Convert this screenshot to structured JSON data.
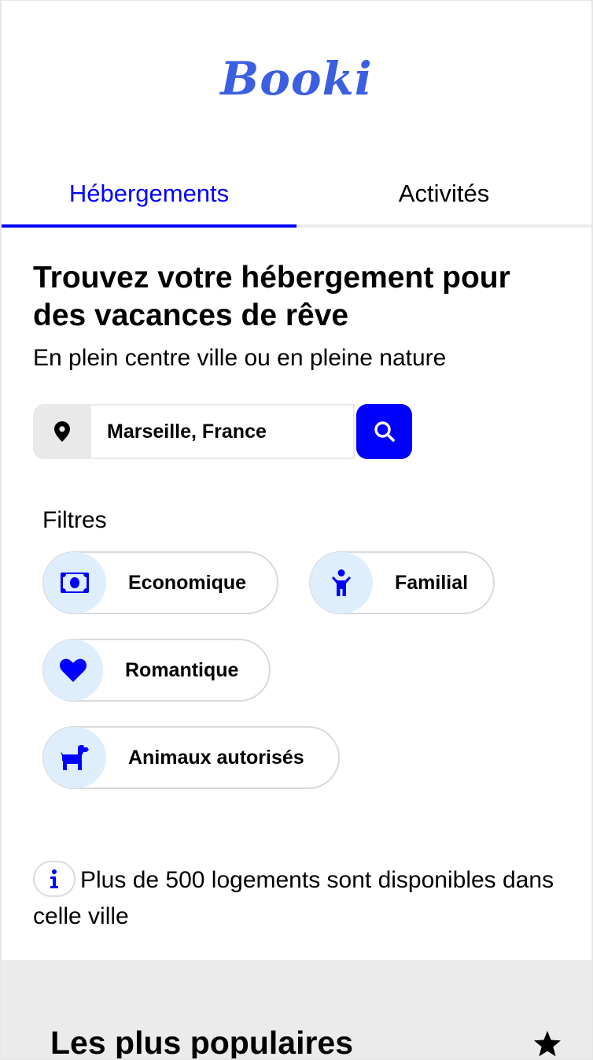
{
  "header": {
    "logo": "Booki"
  },
  "tabs": [
    {
      "label": "Hébergements",
      "active": true
    },
    {
      "label": "Activités",
      "active": false
    }
  ],
  "hero": {
    "title": "Trouvez votre hébergement pour des vacances de rêve",
    "subtitle": "En plein centre ville ou en pleine nature"
  },
  "search": {
    "value": "Marseille, France",
    "location_icon": "map-pin-icon",
    "button_icon": "search-icon"
  },
  "filters": {
    "label": "Filtres",
    "items": [
      {
        "label": "Economique",
        "icon": "money-bill-icon"
      },
      {
        "label": "Familial",
        "icon": "child-icon"
      },
      {
        "label": "Romantique",
        "icon": "heart-icon"
      },
      {
        "label": "Animaux autorisés",
        "icon": "dog-icon"
      }
    ]
  },
  "info": {
    "icon": "info-icon",
    "text": "Plus de 500 logements sont disponibles dans celle ville"
  },
  "popular": {
    "title": "Les plus populaires",
    "icon": "star-icon"
  },
  "colors": {
    "accent": "#0000ff",
    "logo": "#3b5fe0",
    "chip_icon_bg": "#dfeefc",
    "section_bg": "#ebebeb"
  }
}
